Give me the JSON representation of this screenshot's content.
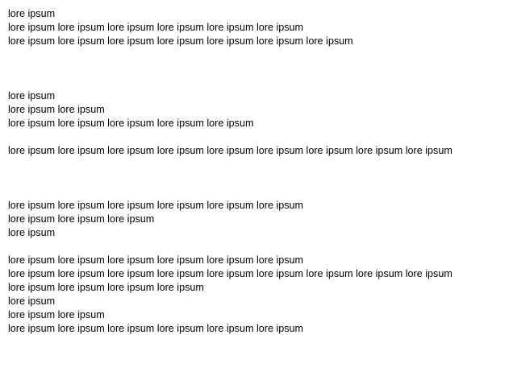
{
  "lines": [
    "lore ipsum",
    "lore ipsum lore ipsum lore ipsum lore ipsum lore ipsum lore ipsum",
    "lore ipsum lore ipsum lore ipsum lore ipsum lore ipsum lore ipsum lore ipsum",
    "lore ipsum",
    "lore ipsum lore ipsum",
    "lore ipsum lore ipsum lore ipsum lore ipsum lore ipsum",
    "lore ipsum lore ipsum lore ipsum lore ipsum lore ipsum lore ipsum lore ipsum lore ipsum lore ipsum",
    "lore ipsum lore ipsum lore ipsum lore ipsum lore ipsum lore ipsum",
    "lore ipsum lore ipsum lore ipsum",
    "lore ipsum",
    "lore ipsum lore ipsum lore ipsum lore ipsum lore ipsum lore ipsum",
    "lore ipsum lore ipsum lore ipsum lore ipsum lore ipsum lore ipsum lore ipsum lore ipsum lore ipsum",
    "lore ipsum lore ipsum lore ipsum lore ipsum",
    "lore ipsum",
    "lore ipsum lore ipsum",
    "lore ipsum lore ipsum lore ipsum lore ipsum lore ipsum lore ipsum"
  ]
}
